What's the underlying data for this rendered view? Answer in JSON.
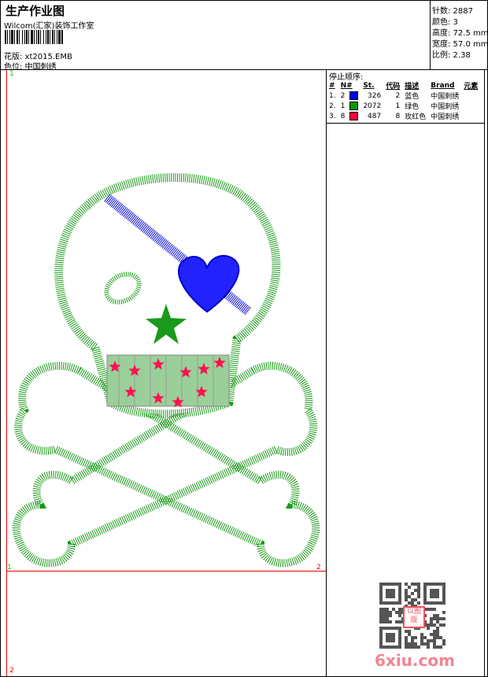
{
  "header": {
    "title": "生产作业图",
    "company": "Wilcom(汇家)装饰工作室",
    "file_label": "花版: xt2015.EMB",
    "colorway_label": "色位: 中国刺绣"
  },
  "info": {
    "stitches": "针数: 2887",
    "colors": "颜色: 3",
    "height": "高度: 72.5 mm",
    "width": "宽度: 57.0 mm",
    "scale": "比例: 2.38"
  },
  "stop_sequence": {
    "title": "停止顺序:",
    "columns": [
      "#",
      "N#",
      "St.",
      "代码",
      "描述",
      "Brand",
      "元素"
    ],
    "rows": [
      {
        "idx": "1.",
        "n": "2",
        "color": "#0000ff",
        "st": "326",
        "code": "2",
        "desc": "蓝色",
        "brand": "中国刺绣"
      },
      {
        "idx": "2.",
        "n": "1",
        "color": "#009900",
        "st": "2072",
        "code": "1",
        "desc": "绿色",
        "brand": "中国刺绣"
      },
      {
        "idx": "3.",
        "n": "8",
        "color": "#ff0040",
        "st": "487",
        "code": "8",
        "desc": "玫红色",
        "brand": "中国刺绣"
      }
    ]
  },
  "markers": {
    "top_left": "1",
    "bottom_left": "1",
    "bottom_right": "2",
    "page_bottom": "2"
  },
  "watermark": "6xiu.com",
  "qr_stamp": "以图版"
}
